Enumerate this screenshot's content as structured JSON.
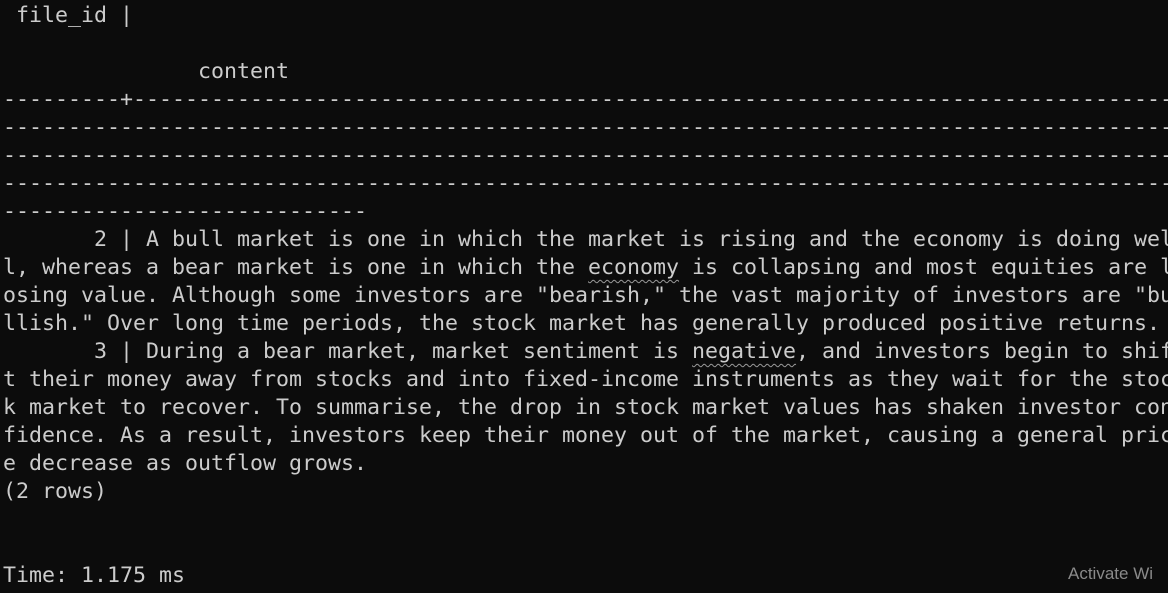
{
  "terminal": {
    "header_file_id": " file_id |",
    "header_content": "               content",
    "separator_1": "---------+----------------------------------------------------------------------------------------------------------------------------------------------------------------------------",
    "separator_2": "-------------------------------------------------------------------------------------------------------------------------------------------------------------------------------------",
    "separator_3": "-------------------------------------------------------------------------------------------------------------------------------------------------------------------------------------",
    "separator_4": "-------------------------------------------------------------------------------------------------------------------------------------------------------------------------------------",
    "separator_5": "----------------------------",
    "rows": [
      {
        "line_1": "       2 | A bull market is one in which the market is rising and the economy is doing wel",
        "line_2a": "l, whereas a bear market is one in which the ",
        "line_2_marked": "economy",
        "line_2b": " is collapsing and most equities are l",
        "line_3": "osing value. Although some investors are \"bearish,\" the vast majority of investors are \"bu",
        "line_4": "llish.\" Over long time periods, the stock market has generally produced positive returns."
      },
      {
        "line_1a": "       3 | During a bear market, market sentiment is ",
        "line_1_marked": "negative",
        "line_1b": ", and investors begin to shif",
        "line_2": "t their money away from stocks and into fixed-income instruments as they wait for the stoc",
        "line_3": "k market to recover. To summarise, the drop in stock market values has shaken investor con",
        "line_4": "fidence. As a result, investors keep their money out of the market, causing a general pric",
        "line_5": "e decrease as outflow grows."
      }
    ],
    "row_count": "(2 rows)",
    "timing": "Time: 1.175 ms"
  },
  "watermark": "Activate Wi",
  "colors": {
    "background": "#0c0c0c",
    "text": "#cccccc",
    "watermark": "#8a8a8a"
  }
}
